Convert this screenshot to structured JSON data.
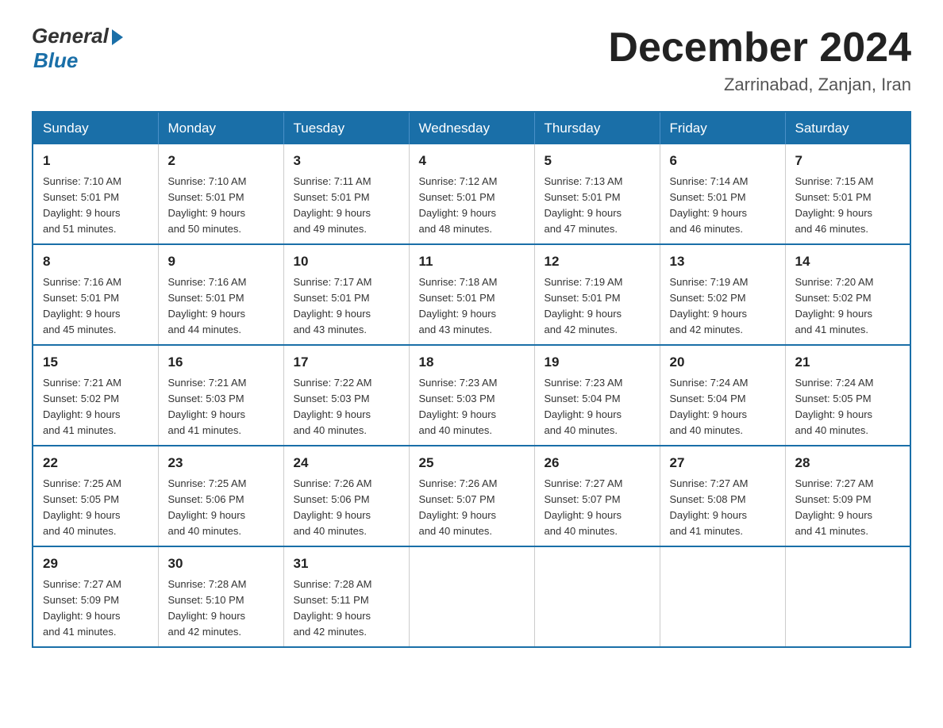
{
  "logo": {
    "general": "General",
    "blue": "Blue"
  },
  "title": "December 2024",
  "location": "Zarrinabad, Zanjan, Iran",
  "weekdays": [
    "Sunday",
    "Monday",
    "Tuesday",
    "Wednesday",
    "Thursday",
    "Friday",
    "Saturday"
  ],
  "weeks": [
    [
      {
        "day": "1",
        "sunrise": "7:10 AM",
        "sunset": "5:01 PM",
        "daylight": "9 hours and 51 minutes."
      },
      {
        "day": "2",
        "sunrise": "7:10 AM",
        "sunset": "5:01 PM",
        "daylight": "9 hours and 50 minutes."
      },
      {
        "day": "3",
        "sunrise": "7:11 AM",
        "sunset": "5:01 PM",
        "daylight": "9 hours and 49 minutes."
      },
      {
        "day": "4",
        "sunrise": "7:12 AM",
        "sunset": "5:01 PM",
        "daylight": "9 hours and 48 minutes."
      },
      {
        "day": "5",
        "sunrise": "7:13 AM",
        "sunset": "5:01 PM",
        "daylight": "9 hours and 47 minutes."
      },
      {
        "day": "6",
        "sunrise": "7:14 AM",
        "sunset": "5:01 PM",
        "daylight": "9 hours and 46 minutes."
      },
      {
        "day": "7",
        "sunrise": "7:15 AM",
        "sunset": "5:01 PM",
        "daylight": "9 hours and 46 minutes."
      }
    ],
    [
      {
        "day": "8",
        "sunrise": "7:16 AM",
        "sunset": "5:01 PM",
        "daylight": "9 hours and 45 minutes."
      },
      {
        "day": "9",
        "sunrise": "7:16 AM",
        "sunset": "5:01 PM",
        "daylight": "9 hours and 44 minutes."
      },
      {
        "day": "10",
        "sunrise": "7:17 AM",
        "sunset": "5:01 PM",
        "daylight": "9 hours and 43 minutes."
      },
      {
        "day": "11",
        "sunrise": "7:18 AM",
        "sunset": "5:01 PM",
        "daylight": "9 hours and 43 minutes."
      },
      {
        "day": "12",
        "sunrise": "7:19 AM",
        "sunset": "5:01 PM",
        "daylight": "9 hours and 42 minutes."
      },
      {
        "day": "13",
        "sunrise": "7:19 AM",
        "sunset": "5:02 PM",
        "daylight": "9 hours and 42 minutes."
      },
      {
        "day": "14",
        "sunrise": "7:20 AM",
        "sunset": "5:02 PM",
        "daylight": "9 hours and 41 minutes."
      }
    ],
    [
      {
        "day": "15",
        "sunrise": "7:21 AM",
        "sunset": "5:02 PM",
        "daylight": "9 hours and 41 minutes."
      },
      {
        "day": "16",
        "sunrise": "7:21 AM",
        "sunset": "5:03 PM",
        "daylight": "9 hours and 41 minutes."
      },
      {
        "day": "17",
        "sunrise": "7:22 AM",
        "sunset": "5:03 PM",
        "daylight": "9 hours and 40 minutes."
      },
      {
        "day": "18",
        "sunrise": "7:23 AM",
        "sunset": "5:03 PM",
        "daylight": "9 hours and 40 minutes."
      },
      {
        "day": "19",
        "sunrise": "7:23 AM",
        "sunset": "5:04 PM",
        "daylight": "9 hours and 40 minutes."
      },
      {
        "day": "20",
        "sunrise": "7:24 AM",
        "sunset": "5:04 PM",
        "daylight": "9 hours and 40 minutes."
      },
      {
        "day": "21",
        "sunrise": "7:24 AM",
        "sunset": "5:05 PM",
        "daylight": "9 hours and 40 minutes."
      }
    ],
    [
      {
        "day": "22",
        "sunrise": "7:25 AM",
        "sunset": "5:05 PM",
        "daylight": "9 hours and 40 minutes."
      },
      {
        "day": "23",
        "sunrise": "7:25 AM",
        "sunset": "5:06 PM",
        "daylight": "9 hours and 40 minutes."
      },
      {
        "day": "24",
        "sunrise": "7:26 AM",
        "sunset": "5:06 PM",
        "daylight": "9 hours and 40 minutes."
      },
      {
        "day": "25",
        "sunrise": "7:26 AM",
        "sunset": "5:07 PM",
        "daylight": "9 hours and 40 minutes."
      },
      {
        "day": "26",
        "sunrise": "7:27 AM",
        "sunset": "5:07 PM",
        "daylight": "9 hours and 40 minutes."
      },
      {
        "day": "27",
        "sunrise": "7:27 AM",
        "sunset": "5:08 PM",
        "daylight": "9 hours and 41 minutes."
      },
      {
        "day": "28",
        "sunrise": "7:27 AM",
        "sunset": "5:09 PM",
        "daylight": "9 hours and 41 minutes."
      }
    ],
    [
      {
        "day": "29",
        "sunrise": "7:27 AM",
        "sunset": "5:09 PM",
        "daylight": "9 hours and 41 minutes."
      },
      {
        "day": "30",
        "sunrise": "7:28 AM",
        "sunset": "5:10 PM",
        "daylight": "9 hours and 42 minutes."
      },
      {
        "day": "31",
        "sunrise": "7:28 AM",
        "sunset": "5:11 PM",
        "daylight": "9 hours and 42 minutes."
      },
      null,
      null,
      null,
      null
    ]
  ],
  "labels": {
    "sunrise": "Sunrise:",
    "sunset": "Sunset:",
    "daylight": "Daylight:"
  }
}
